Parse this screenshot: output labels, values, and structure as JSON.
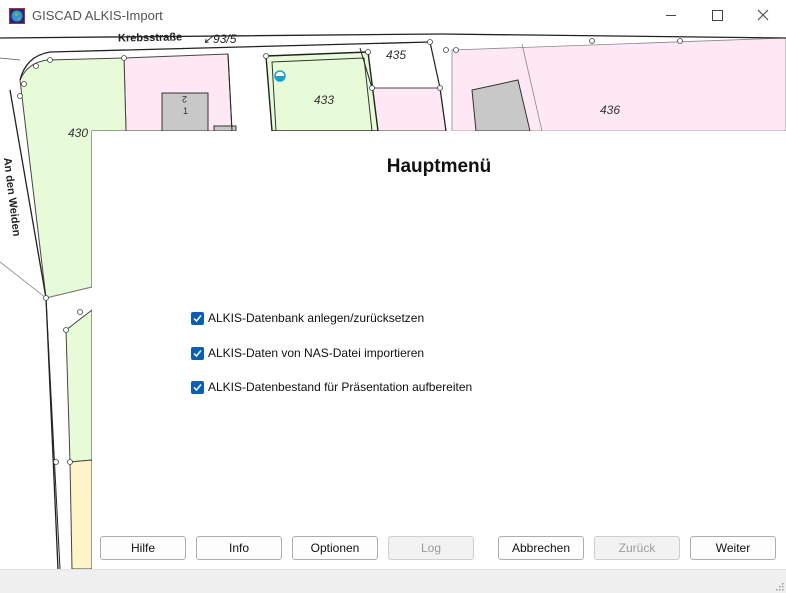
{
  "window": {
    "title": "GISCAD ALKIS-Import"
  },
  "map": {
    "street_label": "Krebsstraße",
    "street_number": "↙93/5",
    "vertical_street": "An den Weiden",
    "parcels": [
      "430",
      "433",
      "435",
      "436"
    ],
    "building_marks": [
      "2",
      "1"
    ]
  },
  "dialog": {
    "heading": "Hauptmenü",
    "options": [
      {
        "label": "ALKIS-Datenbank anlegen/zurücksetzen",
        "checked": true
      },
      {
        "label": "ALKIS-Daten von NAS-Datei importieren",
        "checked": true
      },
      {
        "label": "ALKIS-Datenbestand für Präsentation aufbereiten",
        "checked": true
      }
    ]
  },
  "buttons": {
    "hilfe": "Hilfe",
    "info": "Info",
    "optionen": "Optionen",
    "log": "Log",
    "abbrechen": "Abbrechen",
    "zurueck": "Zurück",
    "weiter": "Weiter"
  },
  "colors": {
    "checkbox": "#0a5fb4",
    "parcel_green": "#e8fbd8",
    "parcel_pink": "#fde8f4",
    "parcel_yellow": "#fff4c8",
    "building_grey": "#c8c8c8"
  }
}
